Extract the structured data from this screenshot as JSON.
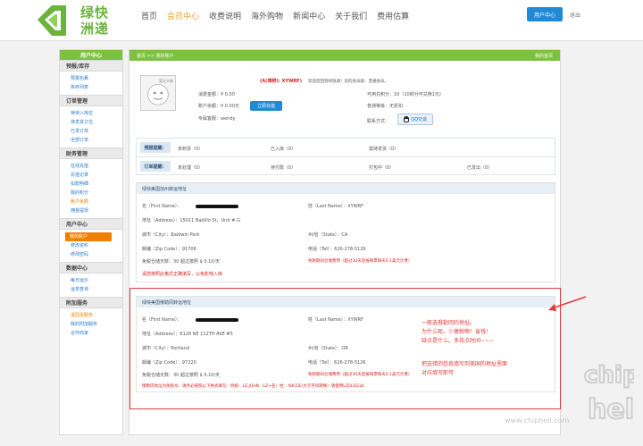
{
  "header": {
    "logo_line1": "绿快",
    "logo_line2": "洲递",
    "nav": [
      "首页",
      "会员中心",
      "收费说明",
      "海外购物",
      "新闻中心",
      "关于我们",
      "费用估算"
    ],
    "nav_active_index": 1,
    "login_label": "用户中心",
    "logout_label": "退出"
  },
  "sidebar": {
    "title": "用户中心",
    "sections": [
      {
        "title": "预报/库存",
        "items": [
          "预报包裹",
          "库存列表"
        ]
      },
      {
        "title": "订单管理",
        "items": [
          "待待入库位",
          "待发货订位",
          "已发订单",
          "全部订单"
        ]
      },
      {
        "title": "财务管理",
        "items": [
          "在线充值",
          "充值记录",
          "扣款明细",
          "我的积分",
          "账户余额",
          "佣金提现"
        ]
      },
      {
        "title": "用户中心",
        "items": [
          "我的账户",
          "修改资料",
          "修改密码"
        ]
      },
      {
        "title": "数据中心",
        "items": [
          "每日运价",
          "运单查询"
        ]
      },
      {
        "title": "附加服务",
        "items": [
          "退回货服务",
          "我的附加服务",
          "合作商家"
        ]
      }
    ],
    "active_item": "我的账户",
    "orange_item": "账户余额"
  },
  "main": {
    "breadcrumb": "首页 >> 我的账户",
    "breadcrumb_right": "我的首页",
    "avatar_label": "暂无头像",
    "welcome_name": "(A(难称): XYWRF)",
    "welcome_text": "欢迎您回到绿快递！您的会员级：普通会员。",
    "consume": "消费金额：¥ 0.00",
    "balance": "账户余额：¥ 0.00元",
    "recharge_btn": "立即充值",
    "referrer": "专属客服：wendy",
    "points": "可用兑积分：10（10积分可兑换1元）",
    "level": "普通等级：无折扣",
    "contact": "联系方式：",
    "qq_label": "QQ交谈",
    "stats": {
      "row1_head": "预报提醒：",
      "row1": [
        "未到货（0）",
        "已入库（0）",
        "需待发货（0）"
      ],
      "row2_head": "订单提醒：",
      "row2": [
        "未处理（0）",
        "待付款（0）",
        "打包中（0）",
        "已发出（0）"
      ]
    },
    "addr1": {
      "title": "绿快美国加州转运地址",
      "first_name": "名（First Name）：",
      "last_name": "姓（Last Name）：XYWRF",
      "address": "地址（Address）：15011 Badillo St，Unit # G",
      "city": "城市（City）：Baldwin Park",
      "state": "州/省（State）：CA",
      "zip": "邮编（Zip Code）：91706",
      "tel": "电话（Tel）：626-278-5126",
      "tax": "免税仓储天数：30 超过按照 $ 0.10/天",
      "red1": "请您按照此格式正确填写，以免影响入库",
      "red2": "免税期间仓储费用（超过30天后按每票每天0.1美元计费）"
    },
    "addr2": {
      "title": "绿快美国俄勒冈转运地址",
      "first_name": "名（First Name）：",
      "last_name": "姓（Last Name）：XYWRF",
      "address": "地址（Address）：6126 NE 112TH AVE #5",
      "city": "城市（City）：Portland",
      "state": "州/省（State）：OR",
      "zip": "邮编（Zip Code）：97220",
      "tel": "电话（Tel）：626-278-5126",
      "tax": "免税仓储天数：30 超过按照 $ 0.10/天",
      "red2": "免税期间仓储费用（超过30天后按每票每天0.1美元计费）",
      "red3": "俄勒冈地址为免税州，请务必按照以下格式填写：例如：LZ.JOHN（LZ+名）姓：ABCDE(大写字母转换）请使用LZ0LSD18"
    }
  },
  "annotation": {
    "line1": "一般选俄勒冈的地址。",
    "line2": "为什么呢。少缴税啊！省钱！",
    "line3": "缺点是什么。多花点时间~~~",
    "line4": "把选错的信息填写到美国的地址里面",
    "line5": "对应填写即可"
  },
  "watermark": {
    "url": "www.chiphell.com",
    "mark": "chip hell"
  },
  "colors": {
    "brand_green": "#7cc242",
    "accent_orange": "#f08000",
    "button_blue": "#1f8bd8",
    "alert_red": "#e63939"
  }
}
